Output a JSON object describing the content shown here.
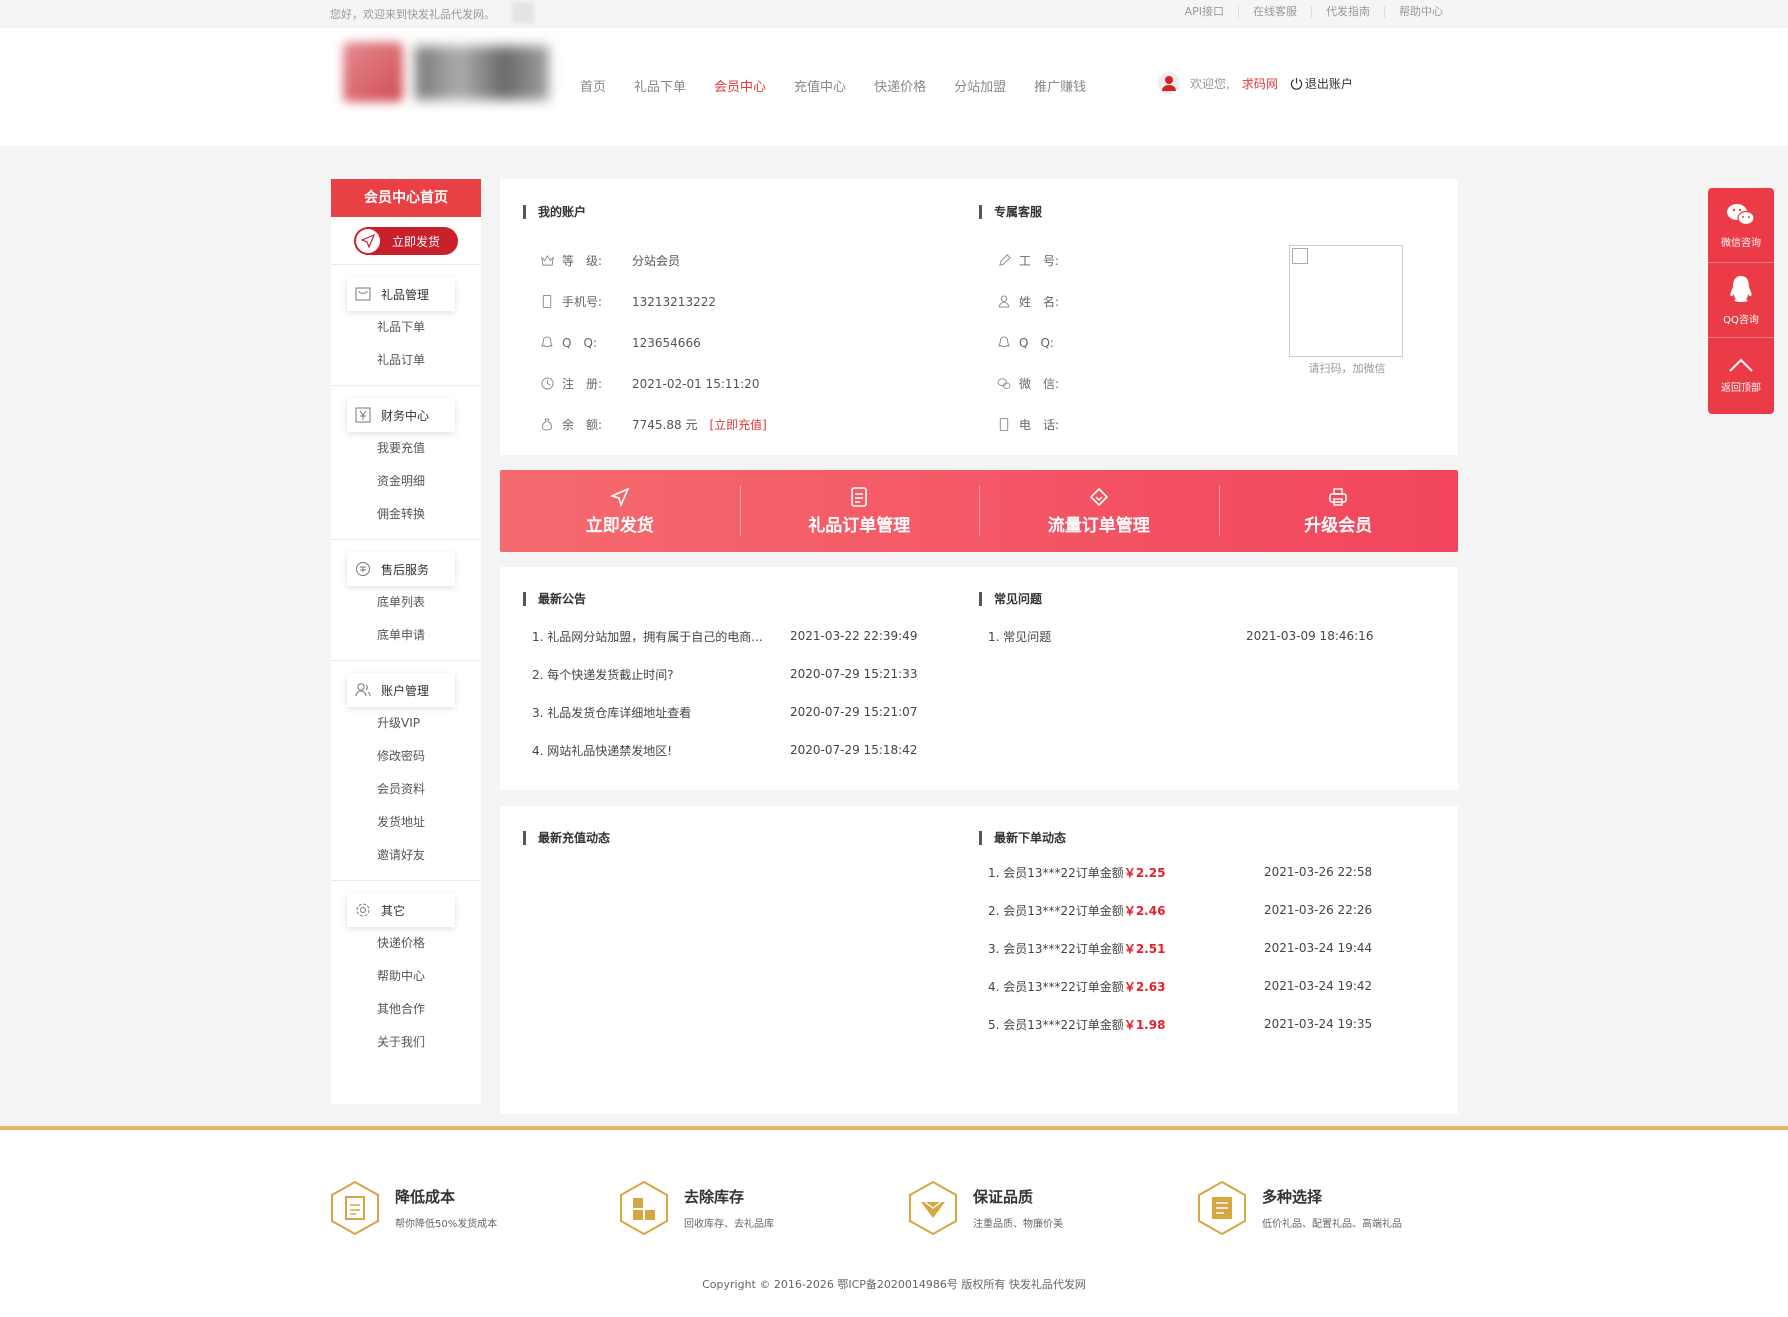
{
  "topbar": {
    "greeting": "您好，欢迎来到快发礼品代发网。",
    "links": [
      "API接口",
      "在线客服",
      "代发指南",
      "帮助中心"
    ]
  },
  "nav": {
    "items": [
      "首页",
      "礼品下单",
      "会员中心",
      "充值中心",
      "快递价格",
      "分站加盟",
      "推广赚钱"
    ],
    "active": "会员中心"
  },
  "user": {
    "welcome": "欢迎您,",
    "name": "求码网",
    "logout": "退出账户"
  },
  "sidebar": {
    "header": "会员中心首页",
    "send_button": "立即发货",
    "sections": [
      {
        "title": "礼品管理",
        "icon": "bag-icon",
        "items": [
          "礼品下单",
          "礼品订单"
        ]
      },
      {
        "title": "财务中心",
        "icon": "money-icon",
        "items": [
          "我要充值",
          "资金明细",
          "佣金转换"
        ]
      },
      {
        "title": "售后服务",
        "icon": "service-icon",
        "items": [
          "底单列表",
          "底单申请"
        ]
      },
      {
        "title": "账户管理",
        "icon": "user-icon",
        "items": [
          "升级VIP",
          "修改密码",
          "会员资料",
          "发货地址",
          "邀请好友"
        ]
      },
      {
        "title": "其它",
        "icon": "gear-icon",
        "items": [
          "快递价格",
          "帮助中心",
          "其他合作",
          "关于我们"
        ]
      }
    ]
  },
  "account": {
    "title": "我的账户",
    "level_label": "等　级:",
    "level": "分站会员",
    "phone_label": "手机号:",
    "phone": "13213213222",
    "qq_label": "Q　Q:",
    "qq": "123654666",
    "reg_label": "注　册:",
    "reg": "2021-02-01 15:11:20",
    "balance_label": "余　额:",
    "balance": "7745.88 元",
    "recharge_link": "[立即充值]"
  },
  "service": {
    "title": "专属客服",
    "id_label": "工　号:",
    "name_label": "姓　名:",
    "qq_label": "Q　Q:",
    "wechat_label": "微　信:",
    "phone_label": "电　话:",
    "qr_caption": "请扫码，加微信"
  },
  "actions": [
    "立即发货",
    "礼品订单管理",
    "流量订单管理",
    "升级会员"
  ],
  "notices": {
    "title": "最新公告",
    "items": [
      {
        "text": "1. 礼品网分站加盟，拥有属于自己的电商...",
        "time": "2021-03-22 22:39:49"
      },
      {
        "text": "2. 每个快递发货截止时间?",
        "time": "2020-07-29 15:21:33"
      },
      {
        "text": "3. 礼品发货仓库详细地址查看",
        "time": "2020-07-29 15:21:07"
      },
      {
        "text": "4. 网站礼品快递禁发地区!",
        "time": "2020-07-29 15:18:42"
      }
    ]
  },
  "faq": {
    "title": "常见问题",
    "items": [
      {
        "text": "1. 常见问题",
        "time": "2021-03-09 18:46:16"
      }
    ]
  },
  "recharge_feed": {
    "title": "最新充值动态"
  },
  "order_feed": {
    "title": "最新下单动态",
    "items": [
      {
        "text": "1. 会员13***22订单金额",
        "amount": "￥2.25",
        "time": "2021-03-26 22:58"
      },
      {
        "text": "2. 会员13***22订单金额",
        "amount": "￥2.46",
        "time": "2021-03-26 22:26"
      },
      {
        "text": "3. 会员13***22订单金额",
        "amount": "￥2.51",
        "time": "2021-03-24 19:44"
      },
      {
        "text": "4. 会员13***22订单金额",
        "amount": "￥2.63",
        "time": "2021-03-24 19:42"
      },
      {
        "text": "5. 会员13***22订单金额",
        "amount": "￥1.98",
        "time": "2021-03-24 19:35"
      }
    ]
  },
  "float_bar": [
    "微信咨询",
    "QQ咨询",
    "返回顶部"
  ],
  "features": [
    {
      "title": "降低成本",
      "sub": "帮你降低50%发货成本"
    },
    {
      "title": "去除库存",
      "sub": "回收库存、去礼品库"
    },
    {
      "title": "保证品质",
      "sub": "注重品质、物廉价美"
    },
    {
      "title": "多种选择",
      "sub": "低价礼品、配置礼品、高端礼品"
    }
  ],
  "copyright": "Copyright © 2016-2026 鄂ICP备2020014986号 版权所有 快发礼品代发网",
  "colors": {
    "accent": "#e94045",
    "gold": "#e0b66a"
  }
}
